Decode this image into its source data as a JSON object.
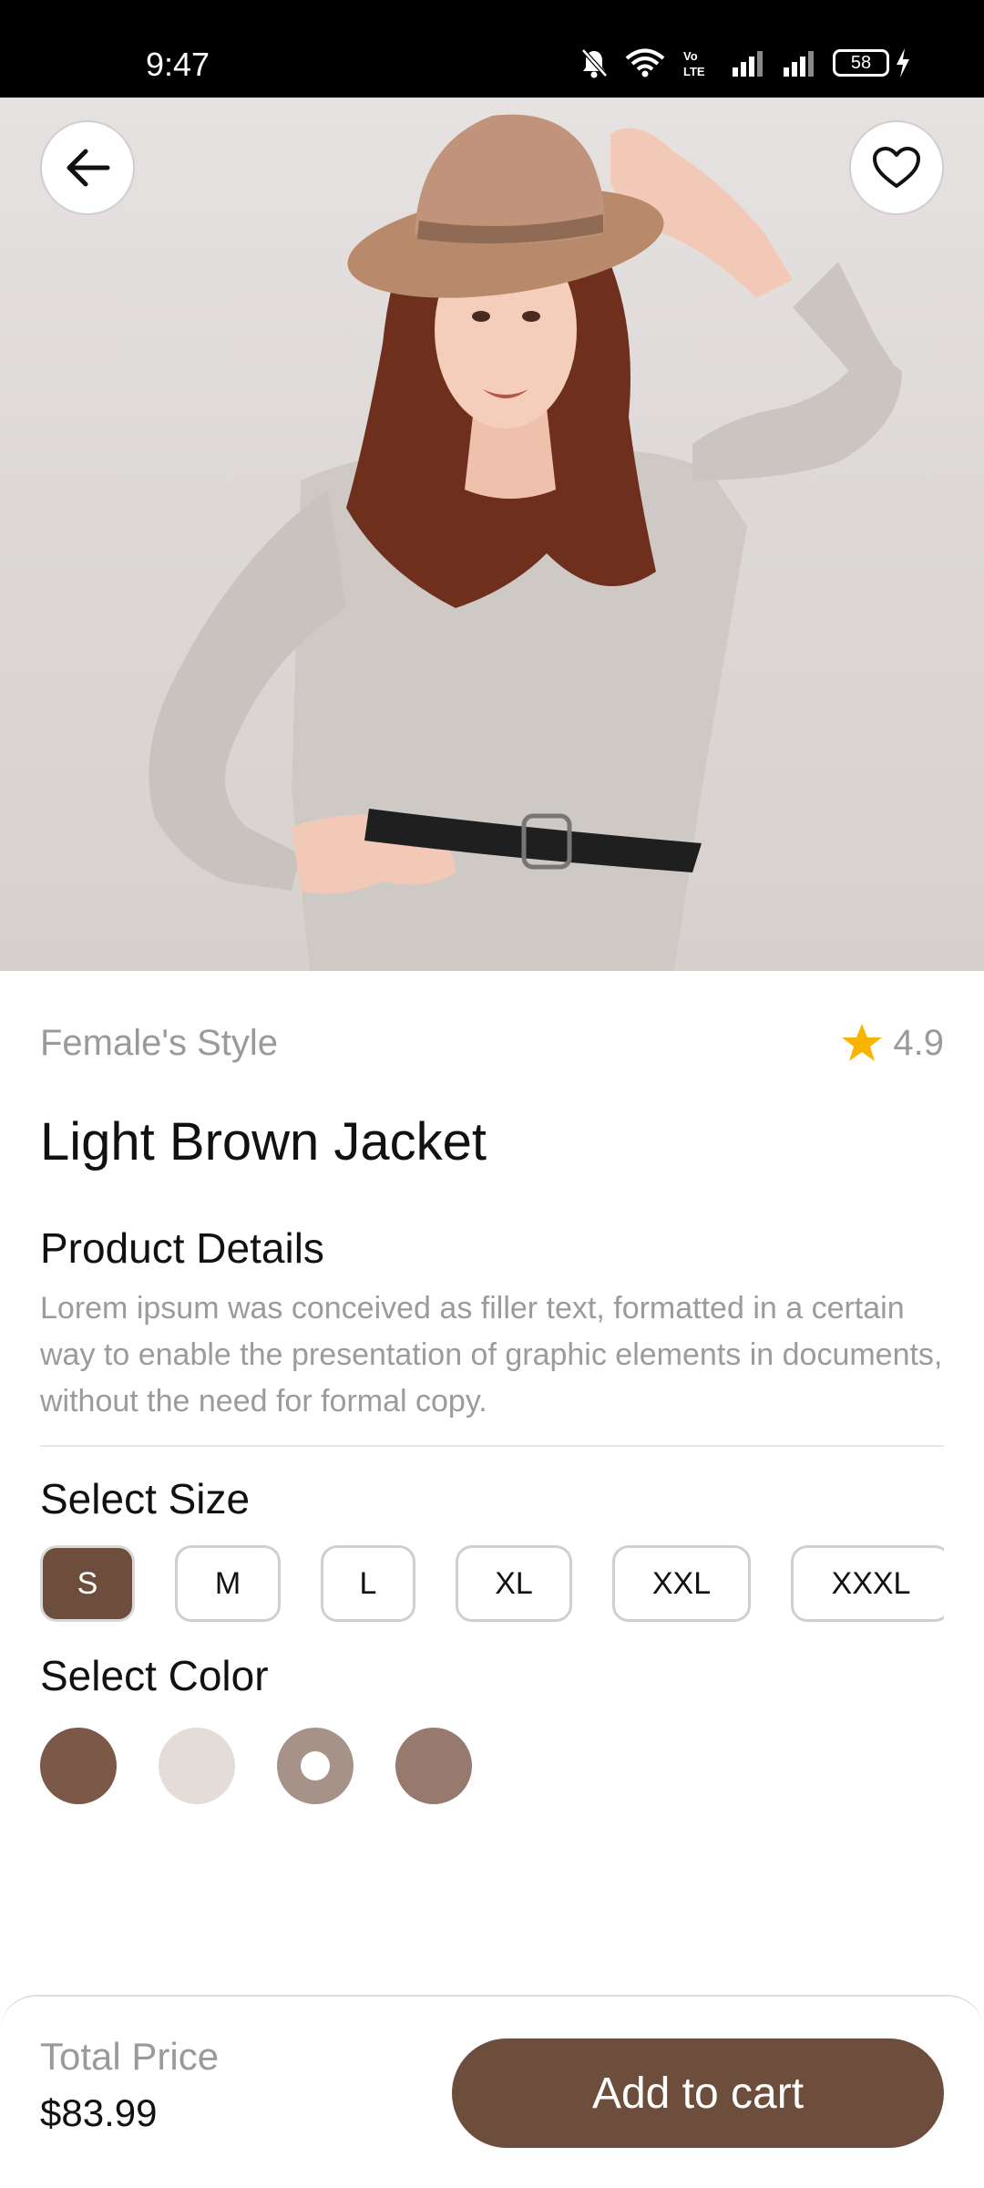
{
  "status_bar": {
    "time": "9:47",
    "battery": "58",
    "network_label": "Vo LTE"
  },
  "hero": {
    "back_icon": "arrow-left-icon",
    "favorite_icon": "heart-outline-icon"
  },
  "product": {
    "category": "Female's Style",
    "rating": "4.9",
    "title": "Light Brown Jacket",
    "details_heading": "Product Details",
    "description": "Lorem ipsum was conceived as filler text, formatted in a certain way to enable the presentation of graphic elements in documents, without the need for formal copy."
  },
  "size": {
    "heading": "Select Size",
    "options": [
      "S",
      "M",
      "L",
      "XL",
      "XXL",
      "XXXL"
    ],
    "selected": "S"
  },
  "color": {
    "heading": "Select Color",
    "options": [
      "#7b5848",
      "#e4dcd8",
      "#a7928a",
      "#97796e"
    ],
    "selected_index": 2
  },
  "checkout": {
    "total_label": "Total Price",
    "total_price": "$83.99",
    "button_label": "Add to cart"
  },
  "colors": {
    "accent": "#6d4e3c",
    "star": "#f7b500",
    "muted_text": "#9a9a9a"
  }
}
